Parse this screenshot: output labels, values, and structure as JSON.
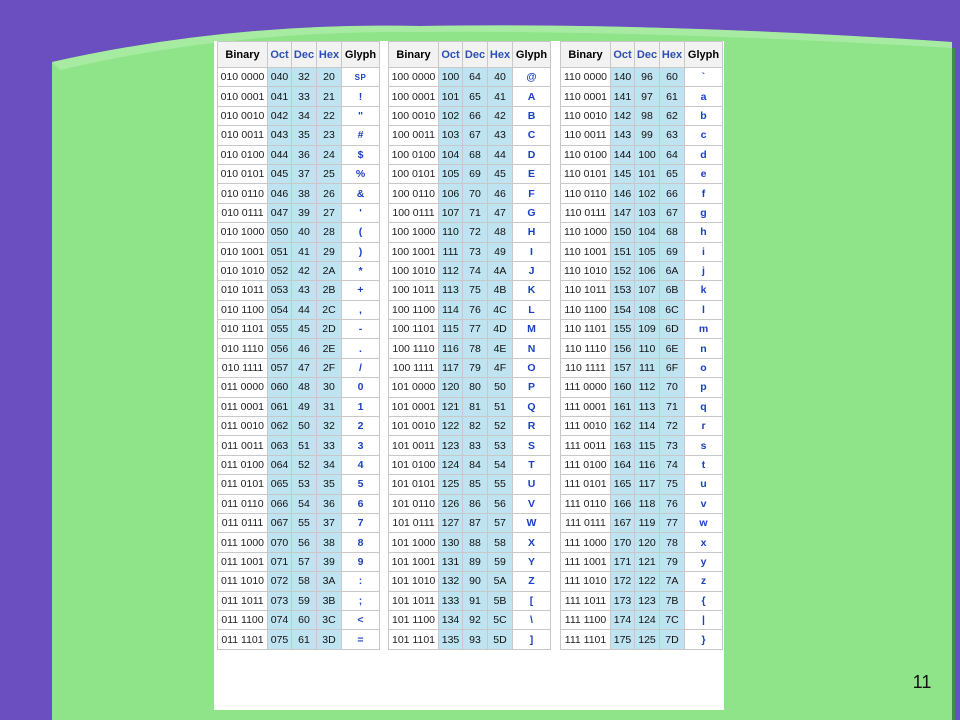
{
  "slide": {
    "number": "11"
  },
  "colors": {
    "background_purple": "#6b4fc0",
    "panel_green": "#8fe48a",
    "column_blue": "#bfe3f0",
    "glyph_blue": "#1b3fc2"
  },
  "table_headers": [
    "Binary",
    "Oct",
    "Dec",
    "Hex",
    "Glyph"
  ],
  "tables": [
    {
      "rows": [
        [
          "010 0000",
          "040",
          "32",
          "20",
          "SP"
        ],
        [
          "010 0001",
          "041",
          "33",
          "21",
          "!"
        ],
        [
          "010 0010",
          "042",
          "34",
          "22",
          "\""
        ],
        [
          "010 0011",
          "043",
          "35",
          "23",
          "#"
        ],
        [
          "010 0100",
          "044",
          "36",
          "24",
          "$"
        ],
        [
          "010 0101",
          "045",
          "37",
          "25",
          "%"
        ],
        [
          "010 0110",
          "046",
          "38",
          "26",
          "&"
        ],
        [
          "010 0111",
          "047",
          "39",
          "27",
          "'"
        ],
        [
          "010 1000",
          "050",
          "40",
          "28",
          "("
        ],
        [
          "010 1001",
          "051",
          "41",
          "29",
          ")"
        ],
        [
          "010 1010",
          "052",
          "42",
          "2A",
          "*"
        ],
        [
          "010 1011",
          "053",
          "43",
          "2B",
          "+"
        ],
        [
          "010 1100",
          "054",
          "44",
          "2C",
          ","
        ],
        [
          "010 1101",
          "055",
          "45",
          "2D",
          "-"
        ],
        [
          "010 1110",
          "056",
          "46",
          "2E",
          "."
        ],
        [
          "010 1111",
          "057",
          "47",
          "2F",
          "/"
        ],
        [
          "011 0000",
          "060",
          "48",
          "30",
          "0"
        ],
        [
          "011 0001",
          "061",
          "49",
          "31",
          "1"
        ],
        [
          "011 0010",
          "062",
          "50",
          "32",
          "2"
        ],
        [
          "011 0011",
          "063",
          "51",
          "33",
          "3"
        ],
        [
          "011 0100",
          "064",
          "52",
          "34",
          "4"
        ],
        [
          "011 0101",
          "065",
          "53",
          "35",
          "5"
        ],
        [
          "011 0110",
          "066",
          "54",
          "36",
          "6"
        ],
        [
          "011 0111",
          "067",
          "55",
          "37",
          "7"
        ],
        [
          "011 1000",
          "070",
          "56",
          "38",
          "8"
        ],
        [
          "011 1001",
          "071",
          "57",
          "39",
          "9"
        ],
        [
          "011 1010",
          "072",
          "58",
          "3A",
          ":"
        ],
        [
          "011 1011",
          "073",
          "59",
          "3B",
          ";"
        ],
        [
          "011 1100",
          "074",
          "60",
          "3C",
          "<"
        ],
        [
          "011 1101",
          "075",
          "61",
          "3D",
          "="
        ]
      ]
    },
    {
      "rows": [
        [
          "100 0000",
          "100",
          "64",
          "40",
          "@"
        ],
        [
          "100 0001",
          "101",
          "65",
          "41",
          "A"
        ],
        [
          "100 0010",
          "102",
          "66",
          "42",
          "B"
        ],
        [
          "100 0011",
          "103",
          "67",
          "43",
          "C"
        ],
        [
          "100 0100",
          "104",
          "68",
          "44",
          "D"
        ],
        [
          "100 0101",
          "105",
          "69",
          "45",
          "E"
        ],
        [
          "100 0110",
          "106",
          "70",
          "46",
          "F"
        ],
        [
          "100 0111",
          "107",
          "71",
          "47",
          "G"
        ],
        [
          "100 1000",
          "110",
          "72",
          "48",
          "H"
        ],
        [
          "100 1001",
          "111",
          "73",
          "49",
          "I"
        ],
        [
          "100 1010",
          "112",
          "74",
          "4A",
          "J"
        ],
        [
          "100 1011",
          "113",
          "75",
          "4B",
          "K"
        ],
        [
          "100 1100",
          "114",
          "76",
          "4C",
          "L"
        ],
        [
          "100 1101",
          "115",
          "77",
          "4D",
          "M"
        ],
        [
          "100 1110",
          "116",
          "78",
          "4E",
          "N"
        ],
        [
          "100 1111",
          "117",
          "79",
          "4F",
          "O"
        ],
        [
          "101 0000",
          "120",
          "80",
          "50",
          "P"
        ],
        [
          "101 0001",
          "121",
          "81",
          "51",
          "Q"
        ],
        [
          "101 0010",
          "122",
          "82",
          "52",
          "R"
        ],
        [
          "101 0011",
          "123",
          "83",
          "53",
          "S"
        ],
        [
          "101 0100",
          "124",
          "84",
          "54",
          "T"
        ],
        [
          "101 0101",
          "125",
          "85",
          "55",
          "U"
        ],
        [
          "101 0110",
          "126",
          "86",
          "56",
          "V"
        ],
        [
          "101 0111",
          "127",
          "87",
          "57",
          "W"
        ],
        [
          "101 1000",
          "130",
          "88",
          "58",
          "X"
        ],
        [
          "101 1001",
          "131",
          "89",
          "59",
          "Y"
        ],
        [
          "101 1010",
          "132",
          "90",
          "5A",
          "Z"
        ],
        [
          "101 1011",
          "133",
          "91",
          "5B",
          "["
        ],
        [
          "101 1100",
          "134",
          "92",
          "5C",
          "\\"
        ],
        [
          "101 1101",
          "135",
          "93",
          "5D",
          "]"
        ]
      ]
    },
    {
      "rows": [
        [
          "110 0000",
          "140",
          "96",
          "60",
          "`"
        ],
        [
          "110 0001",
          "141",
          "97",
          "61",
          "a"
        ],
        [
          "110 0010",
          "142",
          "98",
          "62",
          "b"
        ],
        [
          "110 0011",
          "143",
          "99",
          "63",
          "c"
        ],
        [
          "110 0100",
          "144",
          "100",
          "64",
          "d"
        ],
        [
          "110 0101",
          "145",
          "101",
          "65",
          "e"
        ],
        [
          "110 0110",
          "146",
          "102",
          "66",
          "f"
        ],
        [
          "110 0111",
          "147",
          "103",
          "67",
          "g"
        ],
        [
          "110 1000",
          "150",
          "104",
          "68",
          "h"
        ],
        [
          "110 1001",
          "151",
          "105",
          "69",
          "i"
        ],
        [
          "110 1010",
          "152",
          "106",
          "6A",
          "j"
        ],
        [
          "110 1011",
          "153",
          "107",
          "6B",
          "k"
        ],
        [
          "110 1100",
          "154",
          "108",
          "6C",
          "l"
        ],
        [
          "110 1101",
          "155",
          "109",
          "6D",
          "m"
        ],
        [
          "110 1110",
          "156",
          "110",
          "6E",
          "n"
        ],
        [
          "110 1111",
          "157",
          "111",
          "6F",
          "o"
        ],
        [
          "111 0000",
          "160",
          "112",
          "70",
          "p"
        ],
        [
          "111 0001",
          "161",
          "113",
          "71",
          "q"
        ],
        [
          "111 0010",
          "162",
          "114",
          "72",
          "r"
        ],
        [
          "111 0011",
          "163",
          "115",
          "73",
          "s"
        ],
        [
          "111 0100",
          "164",
          "116",
          "74",
          "t"
        ],
        [
          "111 0101",
          "165",
          "117",
          "75",
          "u"
        ],
        [
          "111 0110",
          "166",
          "118",
          "76",
          "v"
        ],
        [
          "111 0111",
          "167",
          "119",
          "77",
          "w"
        ],
        [
          "111 1000",
          "170",
          "120",
          "78",
          "x"
        ],
        [
          "111 1001",
          "171",
          "121",
          "79",
          "y"
        ],
        [
          "111 1010",
          "172",
          "122",
          "7A",
          "z"
        ],
        [
          "111 1011",
          "173",
          "123",
          "7B",
          "{"
        ],
        [
          "111 1100",
          "174",
          "124",
          "7C",
          "|"
        ],
        [
          "111 1101",
          "175",
          "125",
          "7D",
          "}"
        ]
      ]
    }
  ]
}
